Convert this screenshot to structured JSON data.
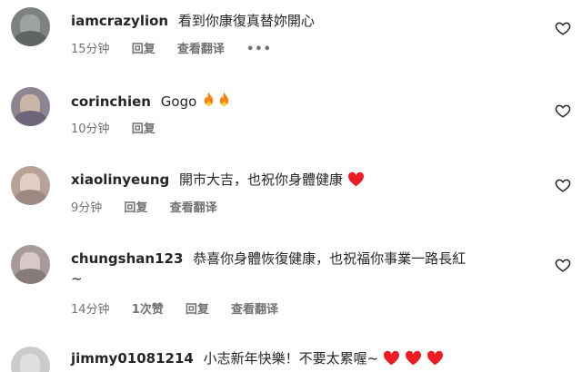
{
  "comments": [
    {
      "username": "iamcrazylion",
      "text": "看到你康復真替妳開心",
      "time": "15分钟",
      "reply": "回复",
      "translate": "查看翻译",
      "more": "•••",
      "avatar_color": "#8a8f8c"
    },
    {
      "username": "corinchien",
      "text": "Gogo",
      "emoji": "fire-fire",
      "time": "10分钟",
      "reply": "回复",
      "avatar_color": "#9a8f9c"
    },
    {
      "username": "xiaolinyeung",
      "text": "開市大吉，也祝你身體健康",
      "emoji": "red-heart",
      "time": "9分钟",
      "reply": "回复",
      "translate": "查看翻译",
      "avatar_color": "#c9b2a5"
    },
    {
      "username": "chungshan123",
      "text": "恭喜你身體恢復健康，也祝福你事業一路長紅",
      "text_line2": "~",
      "time": "14分钟",
      "likes": "1次赞",
      "reply": "回复",
      "translate": "查看翻译",
      "avatar_color": "#b8a9a8"
    },
    {
      "username": "jimmy01081214",
      "text": "小志新年快樂！不要太累喔~",
      "emoji": "red-heart x3",
      "avatar_color": "#c5c9c6"
    }
  ],
  "icons": {
    "like": "heart-outline-icon",
    "accent_red": "#ed1c24"
  }
}
